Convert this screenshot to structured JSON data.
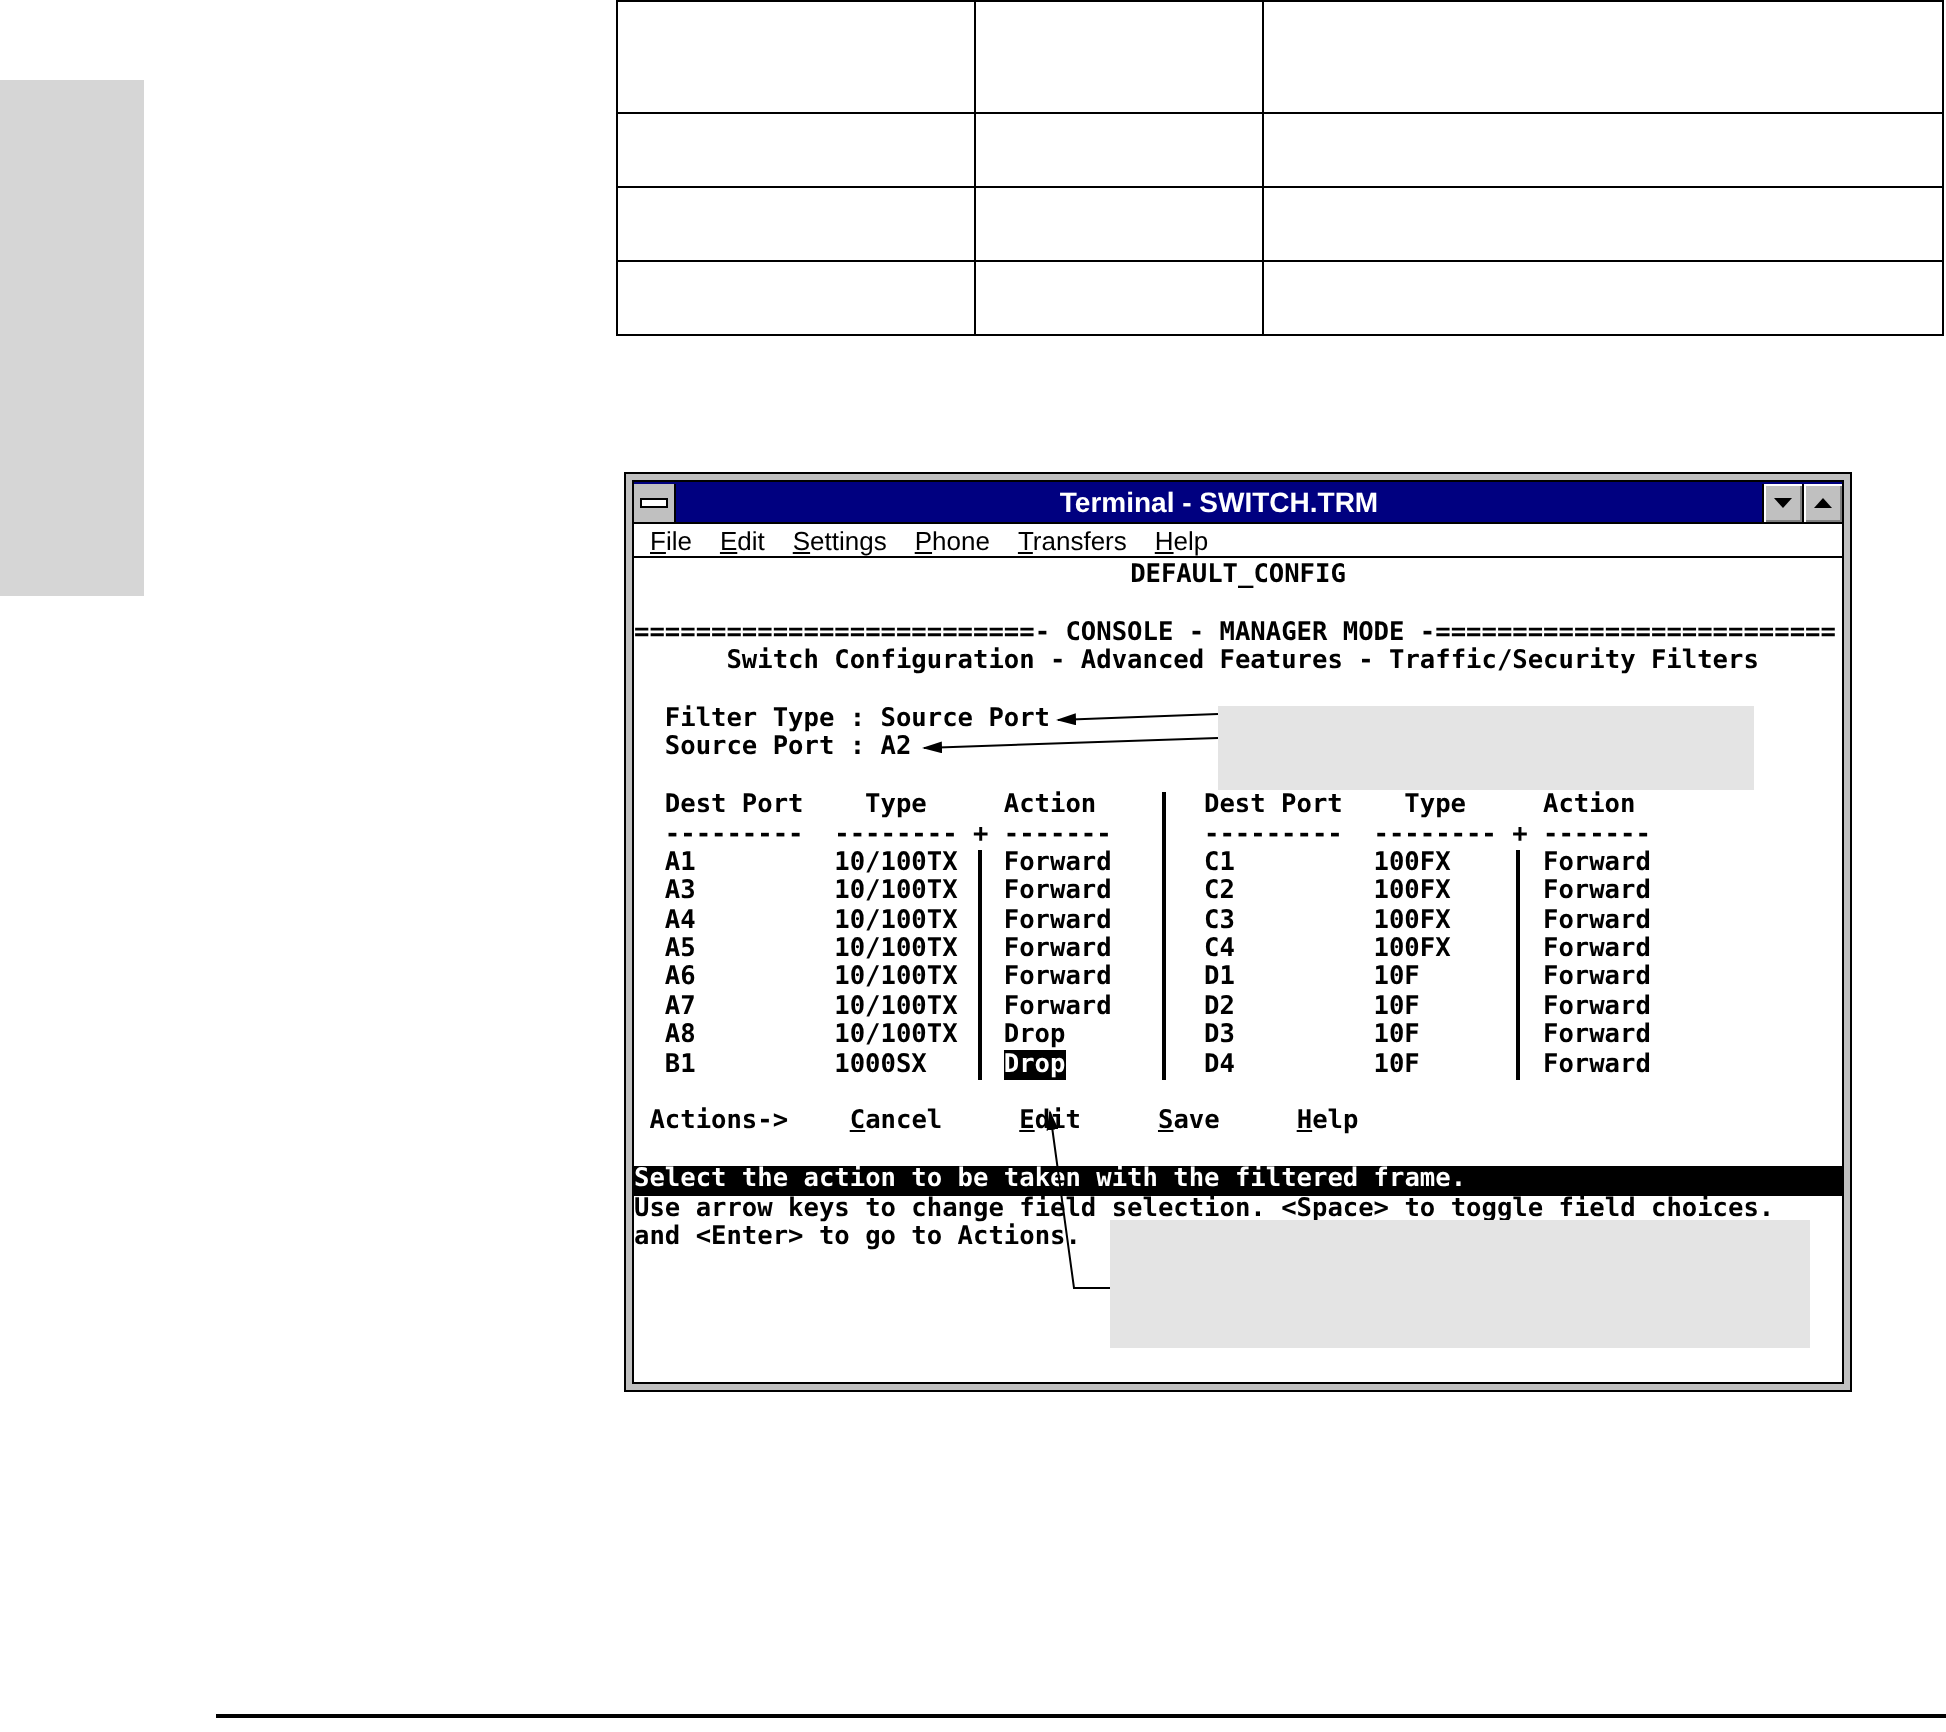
{
  "window": {
    "title": "Terminal - SWITCH.TRM"
  },
  "menu": [
    "File",
    "Edit",
    "Settings",
    "Phone",
    "Transfers",
    "Help"
  ],
  "screen": {
    "banner": "DEFAULT_CONFIG",
    "mode_line": "==========================- CONSOLE - MANAGER MODE -==========================",
    "subtitle": "Switch Configuration - Advanced Features - Traffic/Security Filters",
    "fields": [
      "Filter Type : Source Port",
      "Source Port : A2"
    ]
  },
  "filter_table": {
    "left_columns": [
      {
        "heading": "Dest Port",
        "underline": "---------"
      },
      {
        "heading": "Type",
        "underline": "--------"
      },
      {
        "heading": "Action",
        "underline": "-------"
      }
    ],
    "left_junction": "+",
    "right_columns": [
      {
        "heading": "Dest Port",
        "underline": "---------"
      },
      {
        "heading": "Type",
        "underline": "--------"
      },
      {
        "heading": "Action",
        "underline": "-------"
      }
    ],
    "right_junction": "+",
    "left_rows": [
      {
        "port": "A1",
        "type": "10/100TX",
        "action": "Forward",
        "selected": false
      },
      {
        "port": "A3",
        "type": "10/100TX",
        "action": "Forward",
        "selected": false
      },
      {
        "port": "A4",
        "type": "10/100TX",
        "action": "Forward",
        "selected": false
      },
      {
        "port": "A5",
        "type": "10/100TX",
        "action": "Forward",
        "selected": false
      },
      {
        "port": "A6",
        "type": "10/100TX",
        "action": "Forward",
        "selected": false
      },
      {
        "port": "A7",
        "type": "10/100TX",
        "action": "Forward",
        "selected": false
      },
      {
        "port": "A8",
        "type": "10/100TX",
        "action": "Drop",
        "selected": false
      },
      {
        "port": "B1",
        "type": "1000SX",
        "action": "Drop",
        "selected": true
      }
    ],
    "right_rows": [
      {
        "port": "C1",
        "type": "100FX",
        "action": "Forward",
        "selected": false
      },
      {
        "port": "C2",
        "type": "100FX",
        "action": "Forward",
        "selected": false
      },
      {
        "port": "C3",
        "type": "100FX",
        "action": "Forward",
        "selected": false
      },
      {
        "port": "C4",
        "type": "100FX",
        "action": "Forward",
        "selected": false
      },
      {
        "port": "D1",
        "type": "10F",
        "action": "Forward",
        "selected": false
      },
      {
        "port": "D2",
        "type": "10F",
        "action": "Forward",
        "selected": false
      },
      {
        "port": "D3",
        "type": "10F",
        "action": "Forward",
        "selected": false
      },
      {
        "port": "D4",
        "type": "10F",
        "action": "Forward",
        "selected": false
      }
    ]
  },
  "actions": {
    "label": "Actions->",
    "items": [
      "Cancel",
      "Edit",
      "Save",
      "Help"
    ]
  },
  "status": "Select the action to be taken with the filtered frame.",
  "help_lines": [
    "Use arrow keys to change field selection. <Space> to toggle field choices.",
    "and <Enter> to go to Actions."
  ]
}
